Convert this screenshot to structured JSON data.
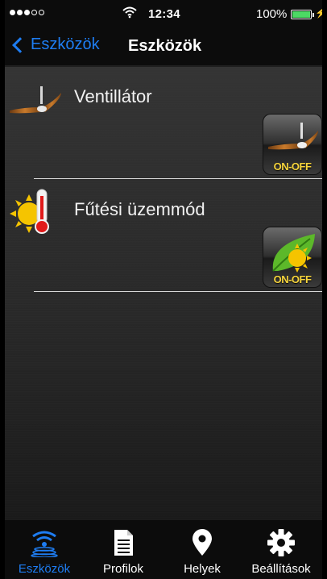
{
  "status_bar": {
    "time": "12:34",
    "battery_percent": "100%",
    "signal_bars_filled": 3,
    "signal_bars_total": 5
  },
  "nav": {
    "back_label": "Eszközök",
    "title": "Eszközök"
  },
  "devices": [
    {
      "name": "Ventillátor",
      "icon": "ceiling-fan-icon",
      "toggle_label": "ON-OFF",
      "toggle_icon": "ceiling-fan-icon"
    },
    {
      "name": "Fűtési üzemmód",
      "icon": "sun-thermometer-icon",
      "toggle_label": "ON-OFF",
      "toggle_icon": "leaf-sun-icon"
    }
  ],
  "tabs": [
    {
      "label": "Eszközök",
      "icon": "wifi-signal-icon",
      "active": true
    },
    {
      "label": "Profilok",
      "icon": "document-icon",
      "active": false
    },
    {
      "label": "Helyek",
      "icon": "location-pin-icon",
      "active": false
    },
    {
      "label": "Beállítások",
      "icon": "gear-icon",
      "active": false
    }
  ],
  "colors": {
    "accent": "#1e7df2",
    "toggle_text": "#f7d53d",
    "battery": "#4cd964"
  }
}
